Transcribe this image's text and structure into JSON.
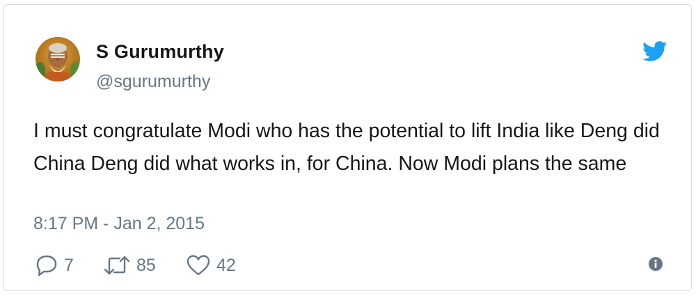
{
  "author": {
    "display_name": "S Gurumurthy",
    "handle": "@sgurumurthy",
    "avatar_icon": "profile-photo"
  },
  "tweet": {
    "text": "I must congratulate Modi who has the potential to lift India like Deng did China Deng did what works in, for China. Now Modi plans the same",
    "timestamp": "8:17 PM - Jan 2, 2015"
  },
  "actions": {
    "reply_count": "7",
    "retweet_count": "85",
    "like_count": "42"
  },
  "icons": {
    "brand": "twitter-bird-icon",
    "reply": "reply-bubble-icon",
    "retweet": "retweet-arrows-icon",
    "like": "heart-icon",
    "info": "info-icon"
  },
  "colors": {
    "twitter_blue": "#1da1f2",
    "text_primary": "#14171a",
    "text_secondary": "#657786",
    "border": "#d6dbe0"
  }
}
